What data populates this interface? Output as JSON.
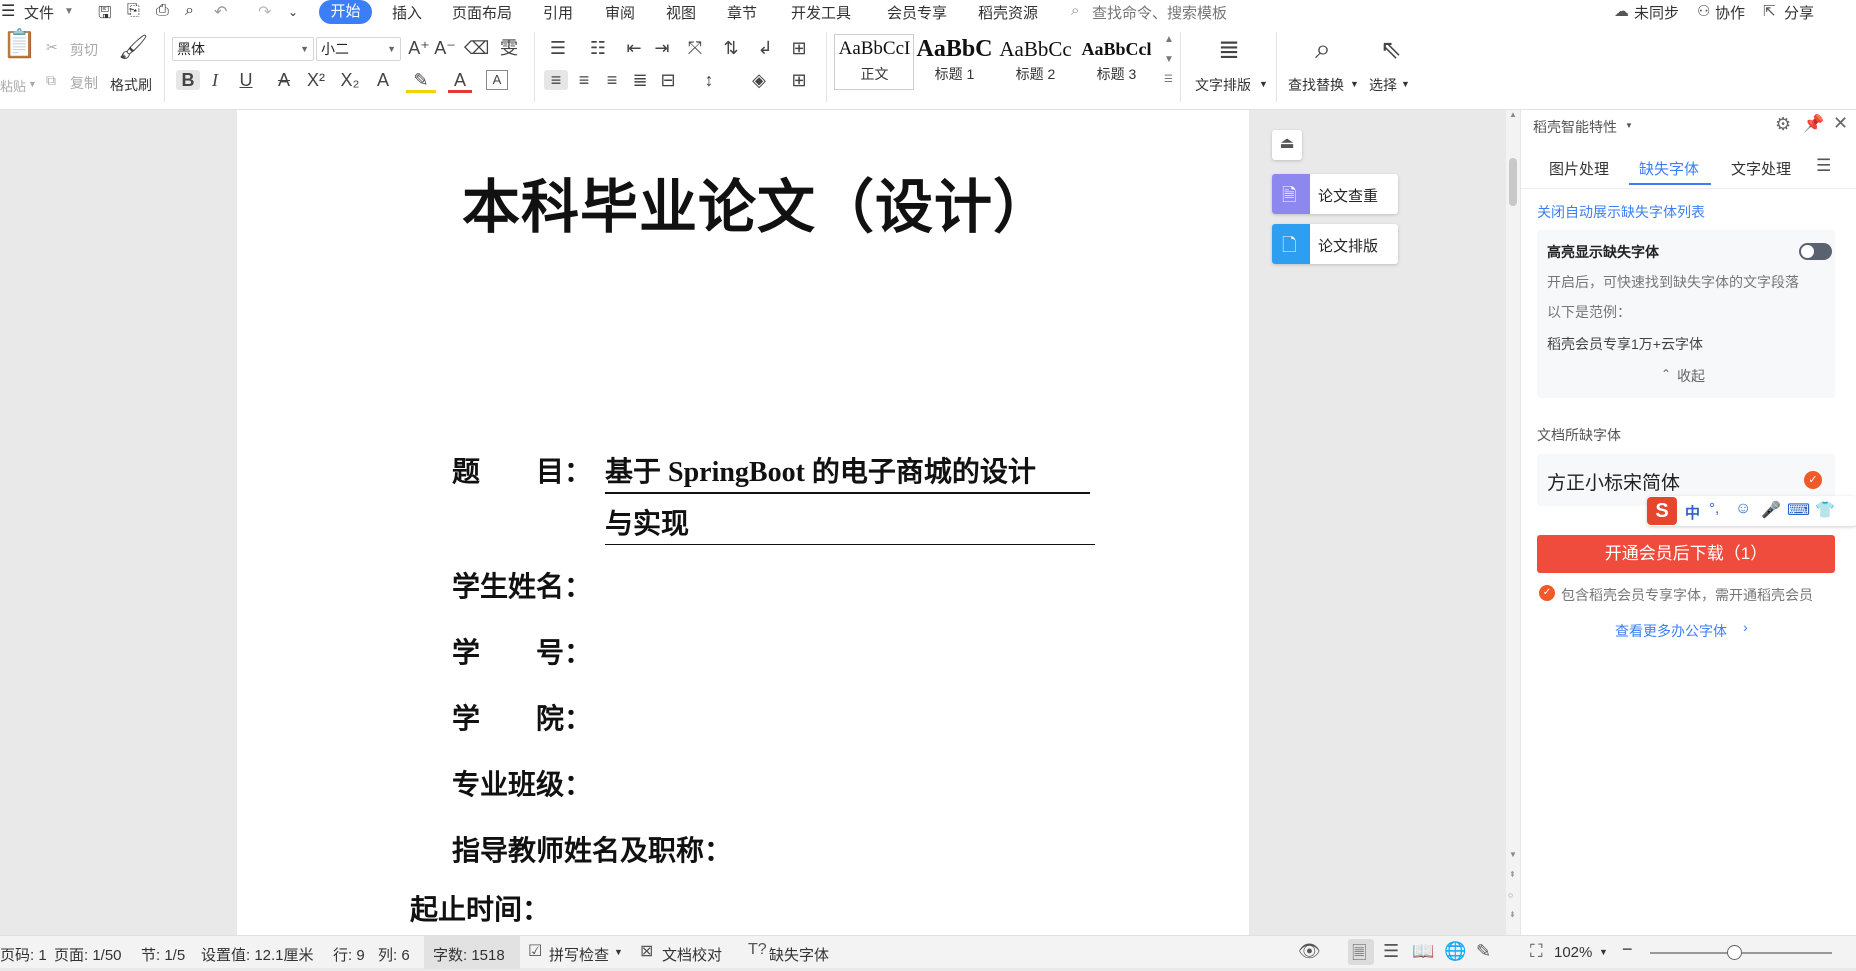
{
  "menubar": {
    "file_label": "文件",
    "tabs": [
      "开始",
      "插入",
      "页面布局",
      "引用",
      "审阅",
      "视图",
      "章节",
      "开发工具",
      "会员专享",
      "稻壳资源"
    ],
    "search_placeholder": "查找命令、搜索模板",
    "sync_label": "未同步",
    "collab_label": "协作",
    "share_label": "分享"
  },
  "ribbon": {
    "paste_label": "粘贴",
    "cut_label": "剪切",
    "copy_label": "复制",
    "format_painter_label": "格式刷",
    "font_name": "黑体",
    "font_size": "小二",
    "styles": [
      {
        "sample": "AaBbCcI",
        "name": "正文"
      },
      {
        "sample": "AaBbC",
        "name": "标题 1"
      },
      {
        "sample": "AaBbCc",
        "name": "标题 2"
      },
      {
        "sample": "AaBbCcl",
        "name": "标题 3"
      }
    ],
    "text_layout_label": "文字排版",
    "find_replace_label": "查找替换",
    "select_label": "选择"
  },
  "document": {
    "title": "本科毕业论文（设计）",
    "fields": {
      "topic_label": "题　　目：",
      "topic_line1": "基于 SpringBoot 的电子商城的设计",
      "topic_line2": "与实现",
      "student_name": "学生姓名：",
      "student_id": "学　　号：",
      "college": "学　　院：",
      "class": "专业班级：",
      "advisor": "指导教师姓名及职称：",
      "period": "起止时间："
    }
  },
  "float_buttons": {
    "check_label": "论文查重",
    "layout_label": "论文排版"
  },
  "right_panel": {
    "title": "稻壳智能特性",
    "tabs": [
      "图片处理",
      "缺失字体",
      "文字处理"
    ],
    "active_tab": "缺失字体",
    "close_auto_link": "关闭自动展示缺失字体列表",
    "highlight_title": "高亮显示缺失字体",
    "highlight_desc": "开启后，可快速找到缺失字体的文字段落",
    "example_label": "以下是范例：",
    "example_text": "稻壳会员专享1万+云字体",
    "collapse_label": "收起",
    "missing_section_title": "文档所缺字体",
    "missing_font": "方正小标宋简体",
    "ime_label": "中",
    "download_button": "开通会员后下载（1）",
    "vip_note": "包含稻壳会员专享字体，需开通稻壳会员",
    "more_fonts_link": "查看更多办公字体",
    "accent_color": "#3b7ff6",
    "download_color": "#f04c3e"
  },
  "statusbar": {
    "page_code": "页码: 1",
    "page": "页面: 1/50",
    "section": "节: 1/5",
    "setting": "设置值: 12.1厘米",
    "row": "行: 9",
    "col": "列: 6",
    "word_count": "字数: 1518",
    "spellcheck": "拼写检查",
    "doc_proof": "文档校对",
    "missing_fonts": "缺失字体",
    "zoom": "102%"
  }
}
